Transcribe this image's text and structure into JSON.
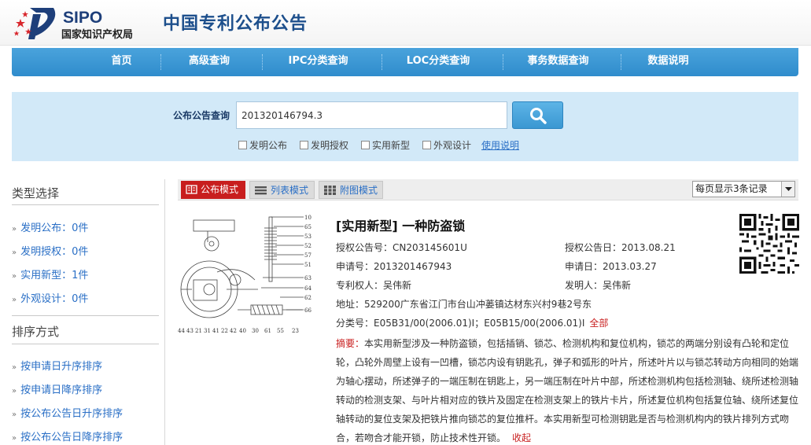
{
  "header": {
    "logo_en": "SIPO",
    "logo_cn": "国家知识产权局",
    "site_title": "中国专利公布公告"
  },
  "nav": {
    "items": [
      "首页",
      "高级查询",
      "IPC分类查询",
      "LOC分类查询",
      "事务数据查询",
      "数据说明"
    ]
  },
  "search": {
    "label": "公布公告查询",
    "value": "201320146794.3",
    "checkboxes": [
      "发明公布",
      "发明授权",
      "实用新型",
      "外观设计"
    ],
    "help_link": "使用说明"
  },
  "sidebar": {
    "type_title": "类型选择",
    "type_items": [
      "发明公布：0件",
      "发明授权：0件",
      "实用新型：1件",
      "外观设计：0件"
    ],
    "sort_title": "排序方式",
    "sort_items": [
      "按申请日升序排序",
      "按申请日降序排序",
      "按公布公告日升序排序",
      "按公布公告日降序排序"
    ]
  },
  "modes": {
    "announce": "公布模式",
    "list": "列表模式",
    "figure": "附图模式",
    "per_page": "每页显示3条记录"
  },
  "result": {
    "title": "[实用新型] 一种防盗锁",
    "grant_no": "授权公告号：CN203145601U",
    "grant_date": "授权公告日：2013.08.21",
    "app_no": "申请号：2013201467943",
    "app_date": "申请日：2013.03.27",
    "patentee": "专利权人：吴伟新",
    "inventor": "发明人：吴伟新",
    "address": "地址：529200广东省江门市台山冲蒌镇达材东兴村9巷2号东",
    "classification": "分类号：E05B31/00(2006.01)I；E05B15/00(2006.01)I",
    "all_link": "全部",
    "abstract_label": "摘要：",
    "abstract_text": "本实用新型涉及一种防盗锁，包括插销、锁芯、检测机构和复位机构，锁芯的两端分别设有凸轮和定位轮，凸轮外周壁上设有一凹槽，锁芯内设有钥匙孔，弹子和弧形的叶片，所述叶片以与锁芯转动方向相同的始端为轴心摆动，所述弹子的一端压制在钥匙上，另一端压制在叶片中部，所述检测机构包括检测轴、绕所述检测轴转动的检测支架、与叶片相对应的铁片及固定在检测支架上的铁片卡片，所述复位机构包括复位轴、绕所述复位轴转动的复位支架及把铁片推向锁芯的复位推杆。本实用新型可检测钥匙是否与检测机构内的铁片排列方式吻合，若吻合才能开锁，防止技术性开锁。",
    "collapse": "收起"
  },
  "drawing_labels": {
    "right": [
      "10",
      "65",
      "53",
      "52",
      "57",
      "51",
      "63",
      "64",
      "62",
      "66"
    ],
    "bottom": [
      "44",
      "43",
      "21",
      "31",
      "41",
      "22",
      "42",
      "40",
      "30",
      "61",
      "55",
      "23"
    ]
  },
  "colors": {
    "nav_blue": "#3896d3",
    "search_bg": "#d2e9f8",
    "title_blue": "#1d4f8c",
    "accent_red": "#c81e1e",
    "link_blue": "#2a6fc6"
  }
}
